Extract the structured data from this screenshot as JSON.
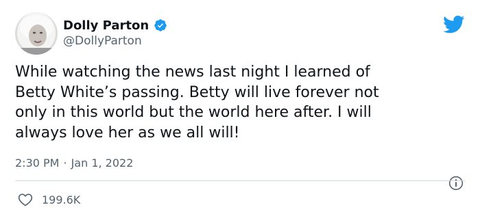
{
  "author": {
    "display_name": "Dolly Parton",
    "handle": "@DollyParton",
    "verified": true,
    "avatar": "portrait-avatar"
  },
  "tweet": {
    "text": "While watching the news last night I learned of\nBetty White’s passing. Betty will live forever not\nonly in this world but the world here after. I will\nalways love her as we all will!",
    "time": "2:30 PM",
    "separator": "·",
    "date": "Jan 1, 2022"
  },
  "engagement": {
    "likes": "199.6K"
  },
  "icons": {
    "brand": "twitter-bird-icon",
    "verified": "verified-badge-icon",
    "info": "info-icon",
    "like": "heart-icon"
  },
  "colors": {
    "brand_blue": "#1d9bf0",
    "text_primary": "#0f1419",
    "text_secondary": "#536471",
    "divider": "#cfd9de"
  }
}
